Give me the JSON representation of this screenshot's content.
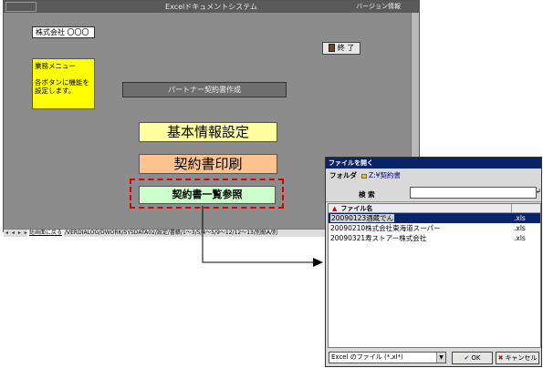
{
  "main_window": {
    "title": "Excelドキュメントシステム",
    "version_info": "バージョン情報",
    "company": "株式会社 〇〇〇",
    "exit_label": "終 了",
    "memo": {
      "title": "業務メニュー",
      "body": "各ボタンに機能を設定します。"
    },
    "partner_contract_button": "パートナー契約書作成",
    "basic_settings_button": "基本情報設定",
    "print_contract_button": "契約書印刷",
    "contract_list_button": "契約書一覧参照",
    "sheet_tabs": {
      "nav": "◂ ◂ ▸ ▸",
      "active": "総画面に戻る",
      "rest": "/VERDIALOG/DWORK/SYSDATA02/設定/書績/1～3/5/4～5/9～12/12～13/別紙A/別"
    }
  },
  "file_dialog": {
    "title": "ファイルを開く",
    "folder_label": "フォルダ",
    "folder_value": "Z:¥契約書",
    "search_label": "検 索",
    "search_value": "",
    "search_go": "↲",
    "column_filename": "ファイル名",
    "sort_icon": "up-triangle",
    "files": [
      {
        "name": "20090123酒蔵でん",
        "ext": ".xls",
        "selected": true
      },
      {
        "name": "20090210株式会社東海道スーパー",
        "ext": ".xls",
        "selected": false
      },
      {
        "name": "20090321寿ストアー株式会社",
        "ext": ".xls",
        "selected": false
      }
    ],
    "file_type": "Excel のファイル (*.xl*)",
    "ok_label": "OK",
    "cancel_label": "キャンセル"
  },
  "colors": {
    "title_bar": "#5a5a5a",
    "workspace": "#8c8c8c",
    "memo_yellow": "#ffff00",
    "basic_button": "#ffffa0",
    "print_button": "#ffc48e",
    "list_button": "#ccffcc",
    "dashed_highlight": "#dd0000",
    "dialog_title": "#0a246a"
  }
}
